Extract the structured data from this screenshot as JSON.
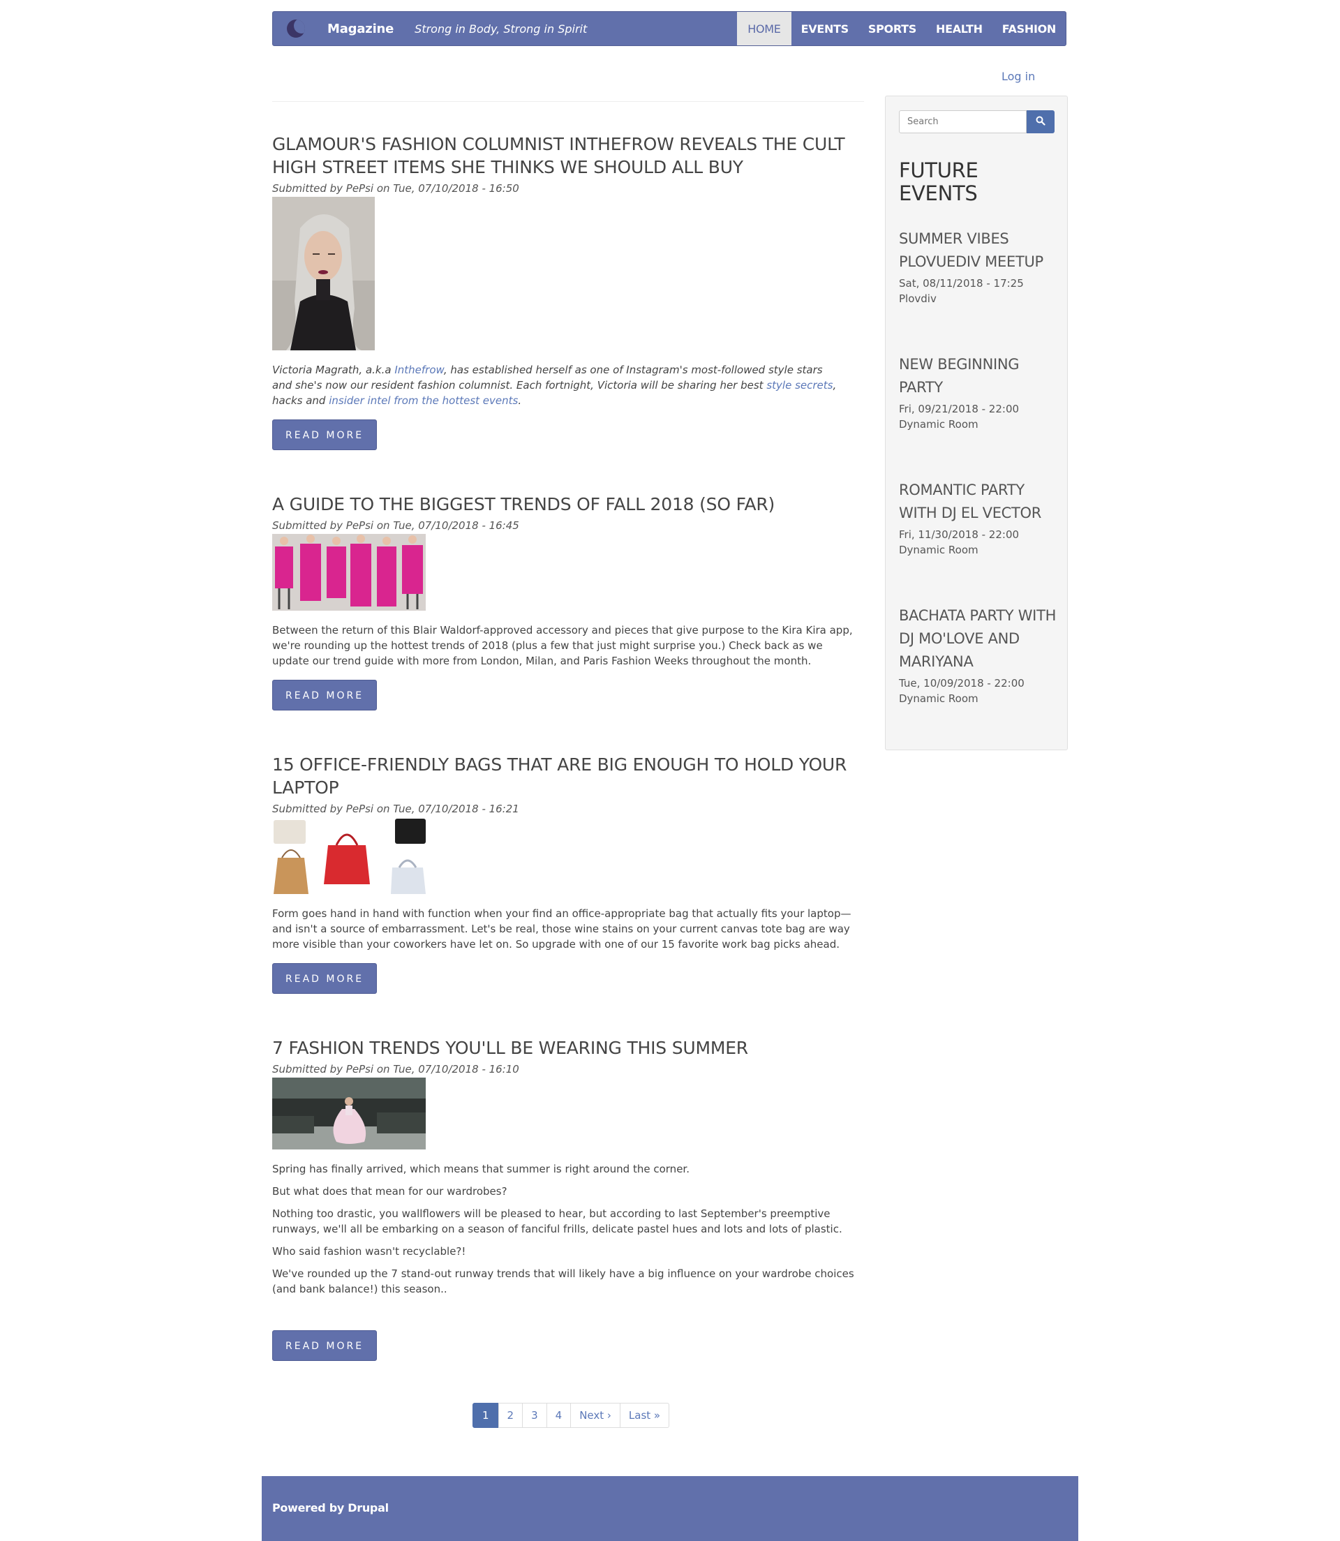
{
  "header": {
    "site_name": "Magazine",
    "slogan": "Strong in Body, Strong in Spirit",
    "menu": [
      "HOME",
      "EVENTS",
      "SPORTS",
      "HEALTH",
      "FASHION"
    ],
    "login": "Log in"
  },
  "articles": [
    {
      "title": "GLAMOUR'S FASHION COLUMNIST INTHEFROW REVEALS THE CULT HIGH STREET ITEMS SHE THINKS WE SHOULD ALL BUY",
      "submitted": "Submitted by PePsi on Tue, 07/10/2018 - 16:50",
      "body": {
        "t1": "Victoria Magrath, a.k.a ",
        "l1": "Inthefrow",
        "t2": ", has established herself as one of Instagram's most-followed style stars and she's now our resident fashion columnist. Each fortnight, Victoria will be sharing her best ",
        "l2": "style secrets",
        "t3": ", hacks and ",
        "l3": "insider intel from the hottest events",
        "t4": "."
      },
      "read_more": "READ MORE"
    },
    {
      "title": "A GUIDE TO THE BIGGEST TRENDS OF FALL 2018 (SO FAR)",
      "submitted": "Submitted by PePsi on Tue, 07/10/2018 - 16:45",
      "body": "Between the return of this Blair Waldorf-approved accessory and pieces that give purpose to the Kira Kira app, we're rounding up the hottest trends of 2018 (plus a few that just might surprise you.) Check back as we update our trend guide with more from London, Milan, and Paris Fashion Weeks throughout the month.",
      "read_more": "READ MORE"
    },
    {
      "title": "15 OFFICE-FRIENDLY BAGS THAT ARE BIG ENOUGH TO HOLD YOUR LAPTOP",
      "submitted": "Submitted by PePsi on Tue, 07/10/2018 - 16:21",
      "body": "Form goes hand in hand with function when your find an office-appropriate bag that actually fits your laptop—and isn't a source of embarrassment. Let's be real, those wine stains on your current canvas tote bag are way more visible than your coworkers have let on. So upgrade with one of our 15 favorite work bag picks ahead.",
      "read_more": "READ MORE"
    },
    {
      "title": "7 FASHION TRENDS YOU'LL BE WEARING THIS SUMMER",
      "submitted": "Submitted by PePsi on Tue, 07/10/2018 - 16:10",
      "paragraphs": [
        "Spring has finally arrived, which means that summer is right around the corner.",
        "But what does that mean for our wardrobes?",
        "Nothing too drastic, you wallflowers will be pleased to hear, but according to last September's preemptive runways, we'll all be embarking on a season of fanciful frills, delicate pastel hues and lots and lots of plastic.",
        "Who said fashion wasn't recyclable?!",
        "We've rounded up the 7 stand-out runway trends that will likely have a big influence on your wardrobe choices (and bank balance!) this season.."
      ],
      "read_more": "READ MORE"
    }
  ],
  "sidebar": {
    "search_placeholder": "Search",
    "search_icon": "search-icon",
    "title": "FUTURE EVENTS",
    "events": [
      {
        "title": "SUMMER VIBES PLOVUEDIV MEETUP",
        "date": "Sat, 08/11/2018 - 17:25",
        "location": "Plovdiv"
      },
      {
        "title": "NEW BEGINNING PARTY",
        "date": "Fri, 09/21/2018 - 22:00",
        "location": "Dynamic Room"
      },
      {
        "title": "ROMANTIC PARTY WITH DJ EL VECTOR",
        "date": "Fri, 11/30/2018 - 22:00",
        "location": "Dynamic Room"
      },
      {
        "title": "BACHATA PARTY WITH DJ MO'LOVE AND MARIYANA",
        "date": "Tue, 10/09/2018 - 22:00",
        "location": "Dynamic Room"
      }
    ]
  },
  "pager": {
    "pages": [
      "1",
      "2",
      "3",
      "4"
    ],
    "current": "1",
    "next": "Next ›",
    "last": "Last »"
  },
  "footer": {
    "text": "Powered by Drupal"
  },
  "colors": {
    "brand": "#6170ab",
    "link": "#5b78b8",
    "button": "#4f6fac"
  }
}
